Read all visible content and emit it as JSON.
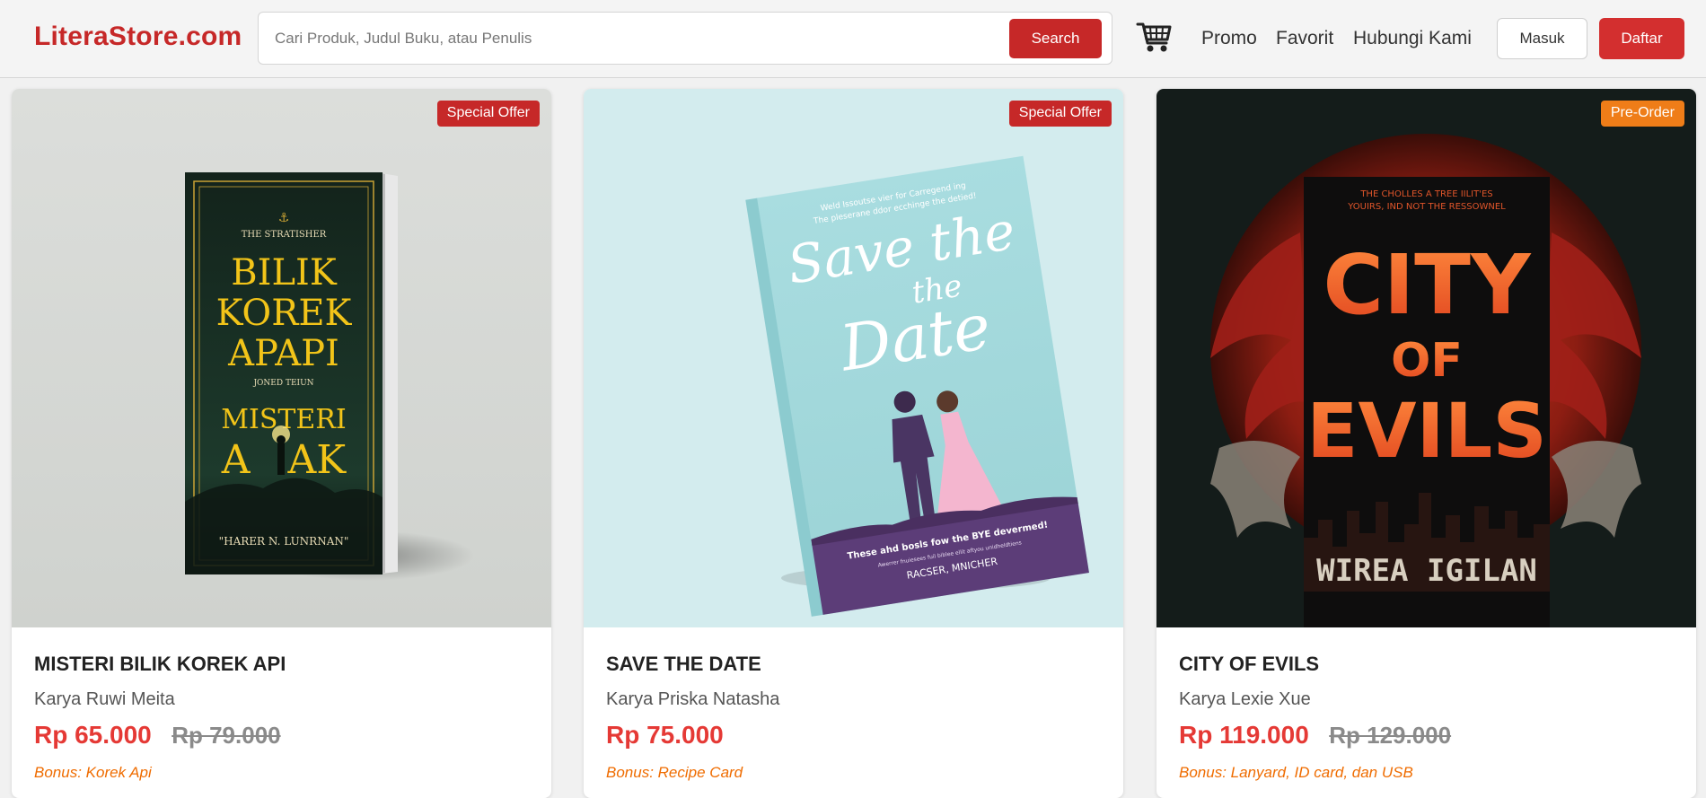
{
  "header": {
    "logo": "LiteraStore.com",
    "search": {
      "placeholder": "Cari Produk, Judul Buku, atau Penulis",
      "value": "",
      "button_label": "Search"
    },
    "cart_icon": "shopping-cart-icon",
    "nav": [
      {
        "label": "Promo"
      },
      {
        "label": "Favorit"
      },
      {
        "label": "Hubungi Kami"
      }
    ],
    "login_label": "Masuk",
    "register_label": "Daftar"
  },
  "colors": {
    "brand": "#c62828",
    "price": "#e53935",
    "bonus": "#ef6c00",
    "badge_special": "#c62828",
    "badge_preorder": "#ef7d18"
  },
  "products": [
    {
      "badge": "Special Offer",
      "cover": {
        "top_text": "THE STRATISHER",
        "title_lines": [
          "BILIK",
          "KOREK",
          "APAPI"
        ],
        "middle_text": "JONED TEIUN",
        "subtitle_lines": [
          "MISTERI",
          "A   AK"
        ],
        "author_text": "\"HARER N. LUNRNAN\""
      },
      "title": "MISTERI BILIK KOREK API",
      "author": "Karya Ruwi Meita",
      "price": "Rp 65.000",
      "old_price": "Rp 79.000",
      "bonus": "Bonus: Korek Api"
    },
    {
      "badge": "Special Offer",
      "cover": {
        "top_lines": [
          "Weld Issoutse vier for Carregend ing",
          "The pleserane ddor ecchinge the detied!"
        ],
        "title_lines": [
          "Save the",
          "the",
          "Date"
        ],
        "bottom_lines": [
          "These ahd bosls fow the BYE devermed!",
          "Awerrer fnuiesees fuil biblee ellit aftyou unidheldtiens",
          "RACSER, MNICHER"
        ]
      },
      "title": "SAVE THE DATE",
      "author": "Karya Priska Natasha",
      "price": "Rp 75.000",
      "old_price": "",
      "bonus": "Bonus: Recipe Card"
    },
    {
      "badge": "Pre-Order",
      "cover": {
        "top_lines": [
          "THE CHOLLES A TREE IILIT'ES",
          "YOUIRS, IND NOT THE RESSOWNEL"
        ],
        "title_lines": [
          "CITY",
          "OF",
          "EVILS"
        ],
        "author_text": "WIREA IGILAN"
      },
      "title": "CITY OF EVILS",
      "author": "Karya Lexie Xue",
      "price": "Rp 119.000",
      "old_price": "Rp 129.000",
      "bonus": "Bonus: Lanyard, ID card, dan USB"
    }
  ]
}
